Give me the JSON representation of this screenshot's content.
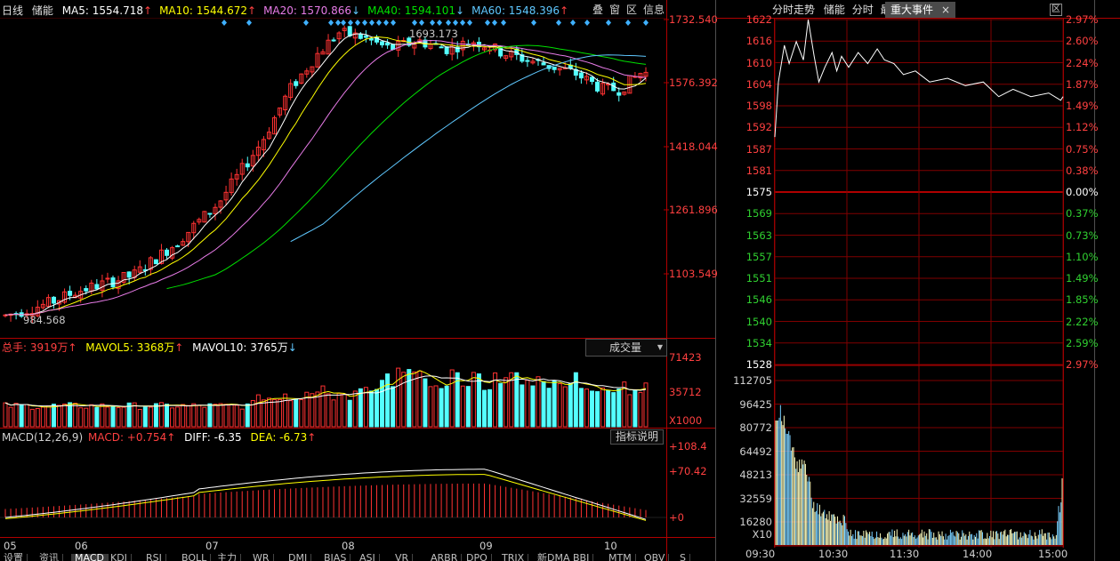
{
  "left": {
    "period": "日线",
    "stock": "储能",
    "ma": [
      {
        "label": "MA5: 1554.718",
        "arrow": "↑",
        "color": "#ffffff"
      },
      {
        "label": "MA10: 1544.672",
        "arrow": "↑",
        "color": "#ffff00"
      },
      {
        "label": "MA20: 1570.866",
        "arrow": "↓",
        "color": "#e77be7"
      },
      {
        "label": "MA40: 1594.101",
        "arrow": "↓",
        "color": "#00e000"
      },
      {
        "label": "MA60: 1548.396",
        "arrow": "↑",
        "color": "#5fc8ff"
      }
    ],
    "buttons": [
      "叠",
      "窗",
      "区",
      "信息"
    ],
    "price_axis": [
      "1732.540",
      "1576.392",
      "1418.044",
      "1261.896",
      "1103.549"
    ],
    "high_label": "1693.173",
    "low_label": "984.568",
    "vol_header": {
      "total": "总手: 3919万",
      "mavol5": "MAVOL5: 3368万",
      "mavol10": "MAVOL10: 3765万"
    },
    "vol_select": "成交量",
    "vol_axis": [
      "71423",
      "35712"
    ],
    "vol_unit": "X1000",
    "macd_header": {
      "name": "MACD(12,26,9)",
      "macd": "MACD: +0.754",
      "diff": "DIFF: -6.35",
      "dea": "DEA: -6.73"
    },
    "macd_help": "指标说明",
    "macd_axis": [
      "+108.4",
      "+70.42",
      "+0"
    ],
    "months": [
      "05",
      "06",
      "07",
      "08",
      "09",
      "10"
    ],
    "tabs": [
      "设置",
      "资讯",
      "MACD",
      "KDJ",
      "RSI",
      "BOLL",
      "主力",
      "WR",
      "DMI",
      "BIAS",
      "ASI",
      "VR",
      "ARBR",
      "DPO",
      "TRIX",
      "新DMA",
      "BBI",
      "MTM",
      "OBV",
      "S"
    ]
  },
  "right": {
    "tabs": [
      "分时走势",
      "储能",
      "分时",
      "最"
    ],
    "event_tab": "重大事件",
    "close_icon": "×",
    "corner_btn": "区",
    "price_axis": [
      "1622",
      "1616",
      "1610",
      "1604",
      "1598",
      "1592",
      "1587",
      "1581",
      "1575",
      "1569",
      "1563",
      "1557",
      "1551",
      "1546",
      "1540",
      "1534",
      "1528"
    ],
    "pct_axis": [
      "2.97%",
      "2.60%",
      "2.24%",
      "1.87%",
      "1.49%",
      "1.12%",
      "0.75%",
      "0.38%",
      "0.00%",
      "0.37%",
      "0.73%",
      "1.10%",
      "1.49%",
      "1.85%",
      "2.22%",
      "2.59%",
      "2.97%"
    ],
    "vol_axis": [
      "112705",
      "96425",
      "80772",
      "64492",
      "48213",
      "32559",
      "16280"
    ],
    "vol_unit": "X10",
    "time_axis": [
      "09:30",
      "10:30",
      "11:30",
      "14:00",
      "15:00"
    ]
  },
  "colors": {
    "up": "#ff3232",
    "down": "#54ffff",
    "grid": "#800000",
    "axis": "#b00000"
  }
}
